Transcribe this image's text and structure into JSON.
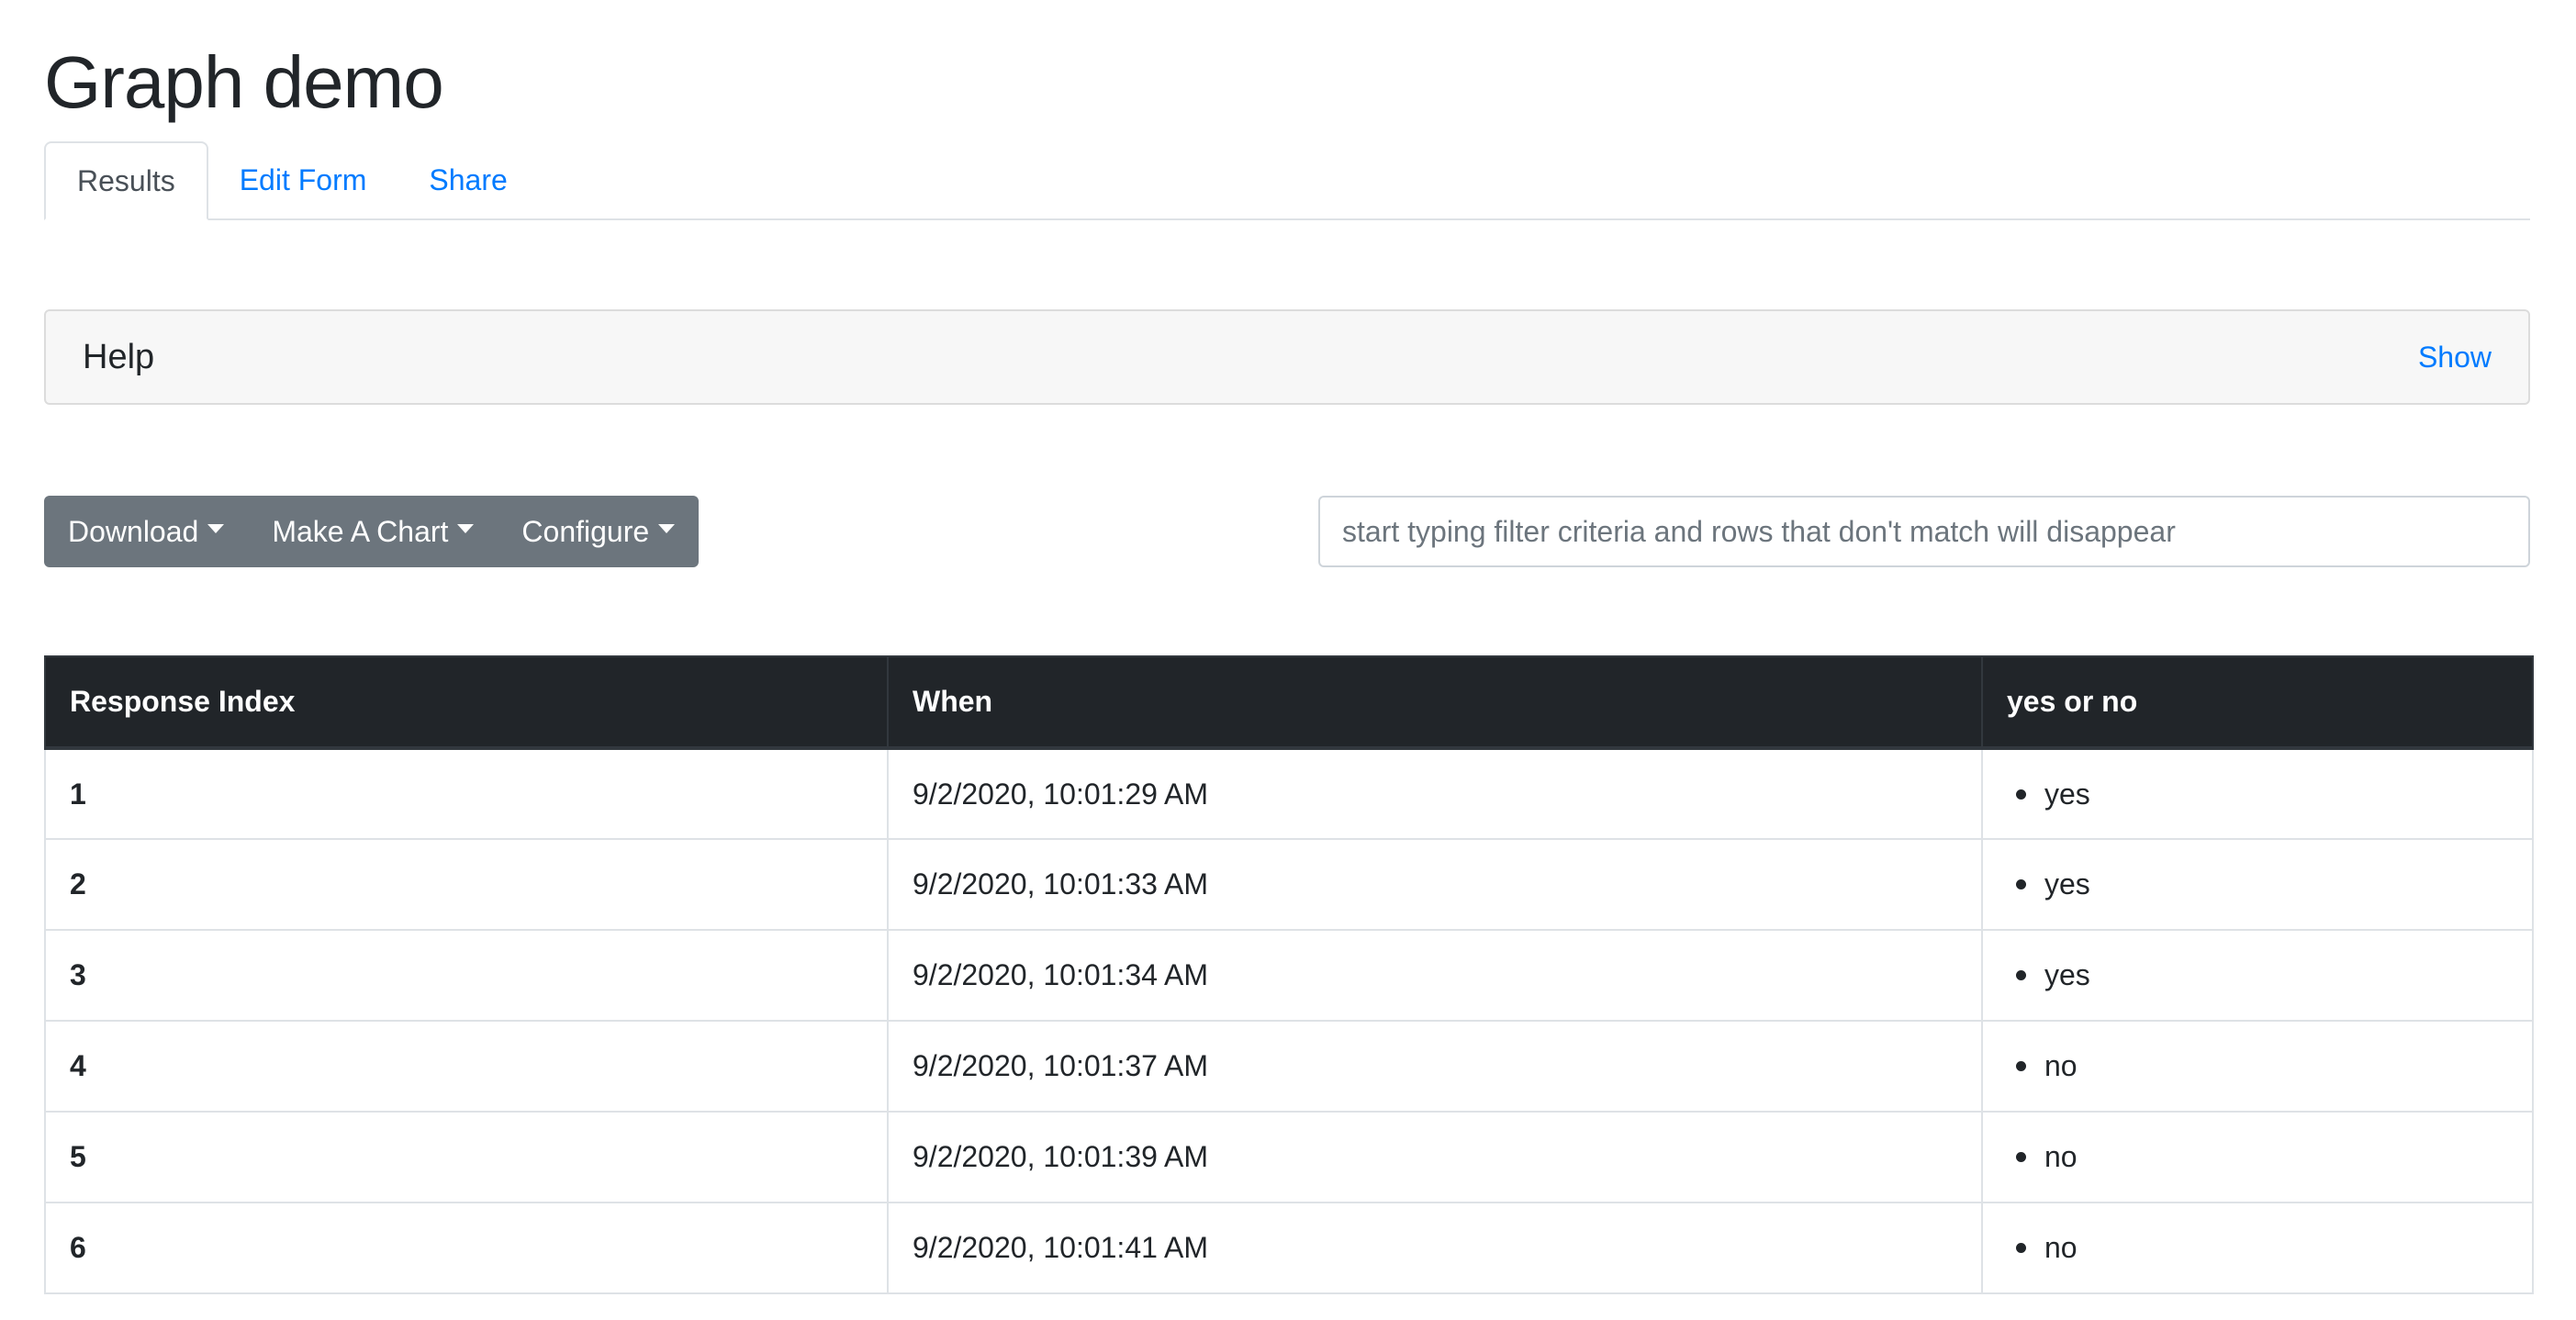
{
  "page": {
    "title": "Graph demo"
  },
  "tabs": [
    {
      "label": "Results",
      "active": true
    },
    {
      "label": "Edit Form",
      "active": false
    },
    {
      "label": "Share",
      "active": false
    }
  ],
  "help": {
    "title": "Help",
    "toggle_label": "Show"
  },
  "toolbar": {
    "download_label": "Download",
    "make_chart_label": "Make A Chart",
    "configure_label": "Configure",
    "caret_icon": "caret-down-icon"
  },
  "filter": {
    "placeholder": "start typing filter criteria and rows that don't match will disappear",
    "value": ""
  },
  "table": {
    "headers": [
      "Response Index",
      "When",
      "yes or no"
    ],
    "rows": [
      {
        "index": "1",
        "when": "9/2/2020, 10:01:29 AM",
        "answer": "yes"
      },
      {
        "index": "2",
        "when": "9/2/2020, 10:01:33 AM",
        "answer": "yes"
      },
      {
        "index": "3",
        "when": "9/2/2020, 10:01:34 AM",
        "answer": "yes"
      },
      {
        "index": "4",
        "when": "9/2/2020, 10:01:37 AM",
        "answer": "no"
      },
      {
        "index": "5",
        "when": "9/2/2020, 10:01:39 AM",
        "answer": "no"
      },
      {
        "index": "6",
        "when": "9/2/2020, 10:01:41 AM",
        "answer": "no"
      }
    ]
  },
  "colors": {
    "link": "#007bff",
    "button_bg": "#6c757d",
    "table_header_bg": "#212529",
    "card_bg": "#f7f7f7"
  }
}
